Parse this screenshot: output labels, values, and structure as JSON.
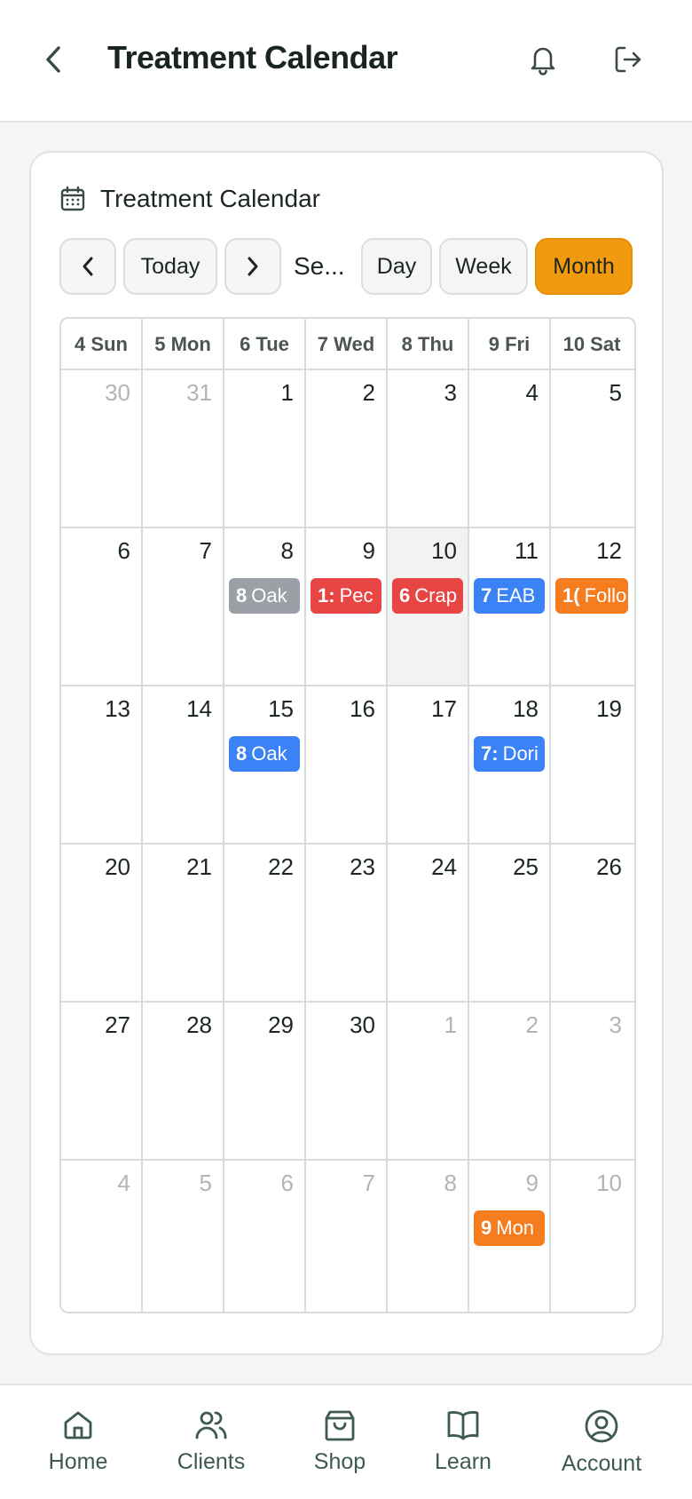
{
  "header": {
    "title": "Treatment Calendar"
  },
  "card": {
    "title": "Treatment Calendar"
  },
  "toolbar": {
    "today": "Today",
    "month_label": "Se...",
    "day": "Day",
    "week": "Week",
    "month": "Month",
    "active_view": "Month"
  },
  "colors": {
    "accent": "#f29a0f",
    "gray": "#9aa0a6",
    "red": "#e84545",
    "blue": "#3b82f6",
    "orange": "#f57c1f",
    "nav_text": "#3c5a4e"
  },
  "calendar": {
    "weekdays": [
      "4 Sun",
      "5 Mon",
      "6 Tue",
      "7 Wed",
      "8 Thu",
      "9 Fri",
      "10 Sat"
    ],
    "weeks": [
      [
        {
          "d": "30",
          "muted": true
        },
        {
          "d": "31",
          "muted": true
        },
        {
          "d": "1"
        },
        {
          "d": "2"
        },
        {
          "d": "3"
        },
        {
          "d": "4"
        },
        {
          "d": "5"
        }
      ],
      [
        {
          "d": "6"
        },
        {
          "d": "7"
        },
        {
          "d": "8",
          "event": {
            "n": "8",
            "t": "Oak",
            "c": "gray"
          }
        },
        {
          "d": "9",
          "event": {
            "n": "1:",
            "t": "Pec",
            "c": "red"
          }
        },
        {
          "d": "10",
          "today": true,
          "event": {
            "n": "6",
            "t": "Crap",
            "c": "red"
          }
        },
        {
          "d": "11",
          "event": {
            "n": "7",
            "t": "EAB",
            "c": "blue"
          }
        },
        {
          "d": "12",
          "event": {
            "n": "1(",
            "t": "Follo",
            "c": "orange"
          }
        }
      ],
      [
        {
          "d": "13"
        },
        {
          "d": "14"
        },
        {
          "d": "15",
          "event": {
            "n": "8",
            "t": "Oak",
            "c": "blue"
          }
        },
        {
          "d": "16"
        },
        {
          "d": "17"
        },
        {
          "d": "18",
          "event": {
            "n": "7:",
            "t": "Dori",
            "c": "blue"
          }
        },
        {
          "d": "19"
        }
      ],
      [
        {
          "d": "20"
        },
        {
          "d": "21"
        },
        {
          "d": "22"
        },
        {
          "d": "23"
        },
        {
          "d": "24"
        },
        {
          "d": "25"
        },
        {
          "d": "26"
        }
      ],
      [
        {
          "d": "27"
        },
        {
          "d": "28"
        },
        {
          "d": "29"
        },
        {
          "d": "30"
        },
        {
          "d": "1",
          "muted": true
        },
        {
          "d": "2",
          "muted": true
        },
        {
          "d": "3",
          "muted": true
        }
      ],
      [
        {
          "d": "4",
          "muted": true
        },
        {
          "d": "5",
          "muted": true
        },
        {
          "d": "6",
          "muted": true
        },
        {
          "d": "7",
          "muted": true
        },
        {
          "d": "8",
          "muted": true
        },
        {
          "d": "9",
          "muted": true,
          "event": {
            "n": "9",
            "t": "Mon",
            "c": "orange"
          }
        },
        {
          "d": "10",
          "muted": true
        }
      ]
    ]
  },
  "nav": [
    {
      "label": "Home",
      "icon": "home-icon"
    },
    {
      "label": "Clients",
      "icon": "users-icon"
    },
    {
      "label": "Shop",
      "icon": "shopping-bag-icon"
    },
    {
      "label": "Learn",
      "icon": "book-icon"
    },
    {
      "label": "Account",
      "icon": "user-circle-icon"
    }
  ]
}
